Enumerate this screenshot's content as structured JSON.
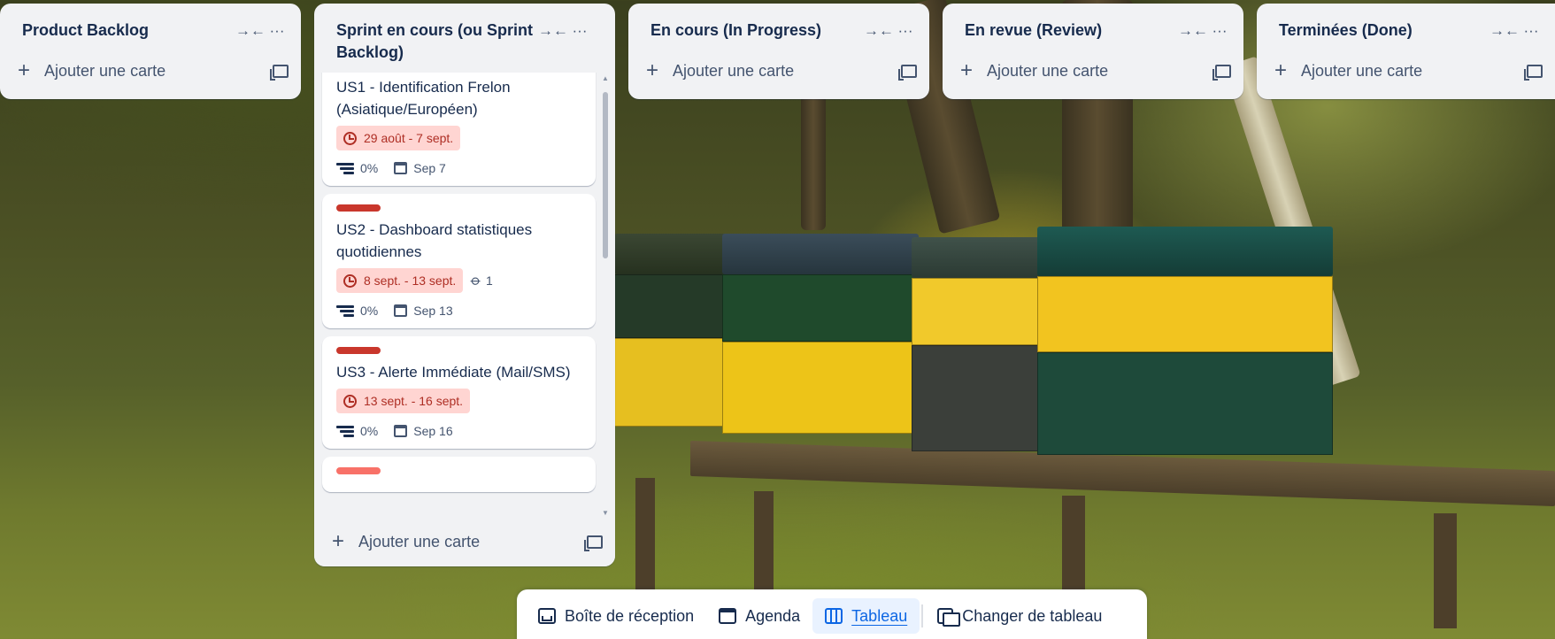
{
  "lists": [
    {
      "title": "Product Backlog",
      "add_label": "Ajouter une carte"
    },
    {
      "title": "Sprint en cours (ou Sprint Backlog)",
      "add_label": "Ajouter une carte"
    },
    {
      "title": "En cours (In Progress)",
      "add_label": "Ajouter une carte"
    },
    {
      "title": "En revue (Review)",
      "add_label": "Ajouter une carte"
    },
    {
      "title": "Terminées (Done)",
      "add_label": "Ajouter une carte"
    }
  ],
  "icons": {
    "collapse": "collapse-icon",
    "more": "more-icon",
    "add": "plus-icon",
    "template": "card-template-icon",
    "clock": "clock-icon",
    "attachment": "paperclip-icon",
    "checklist": "progress-icon",
    "due": "calendar-icon"
  },
  "colors": {
    "label_red": "#c9372c",
    "label_light_red": "#f87168",
    "date_badge_bg": "#ffd5d2",
    "date_badge_text": "#ae2e24",
    "active_blue": "#0c66e4"
  },
  "sprint_cards": [
    {
      "title": "US1 - Identification Frelon (Asiatique/Européen)",
      "dates": "29 août - 7 sept.",
      "attachments": "",
      "progress": "0%",
      "due": "Sep 7"
    },
    {
      "title": "US2 - Dashboard statistiques quotidiennes",
      "dates": "8 sept. - 13 sept.",
      "attachments": "1",
      "progress": "0%",
      "due": "Sep 13"
    },
    {
      "title": "US3 - Alerte Immédiate (Mail/SMS)",
      "dates": "13 sept. - 16 sept.",
      "attachments": "",
      "progress": "0%",
      "due": "Sep 16"
    }
  ],
  "switcher": {
    "inbox": "Boîte de réception",
    "agenda": "Agenda",
    "board": "Tableau",
    "switch": "Changer de tableau"
  }
}
